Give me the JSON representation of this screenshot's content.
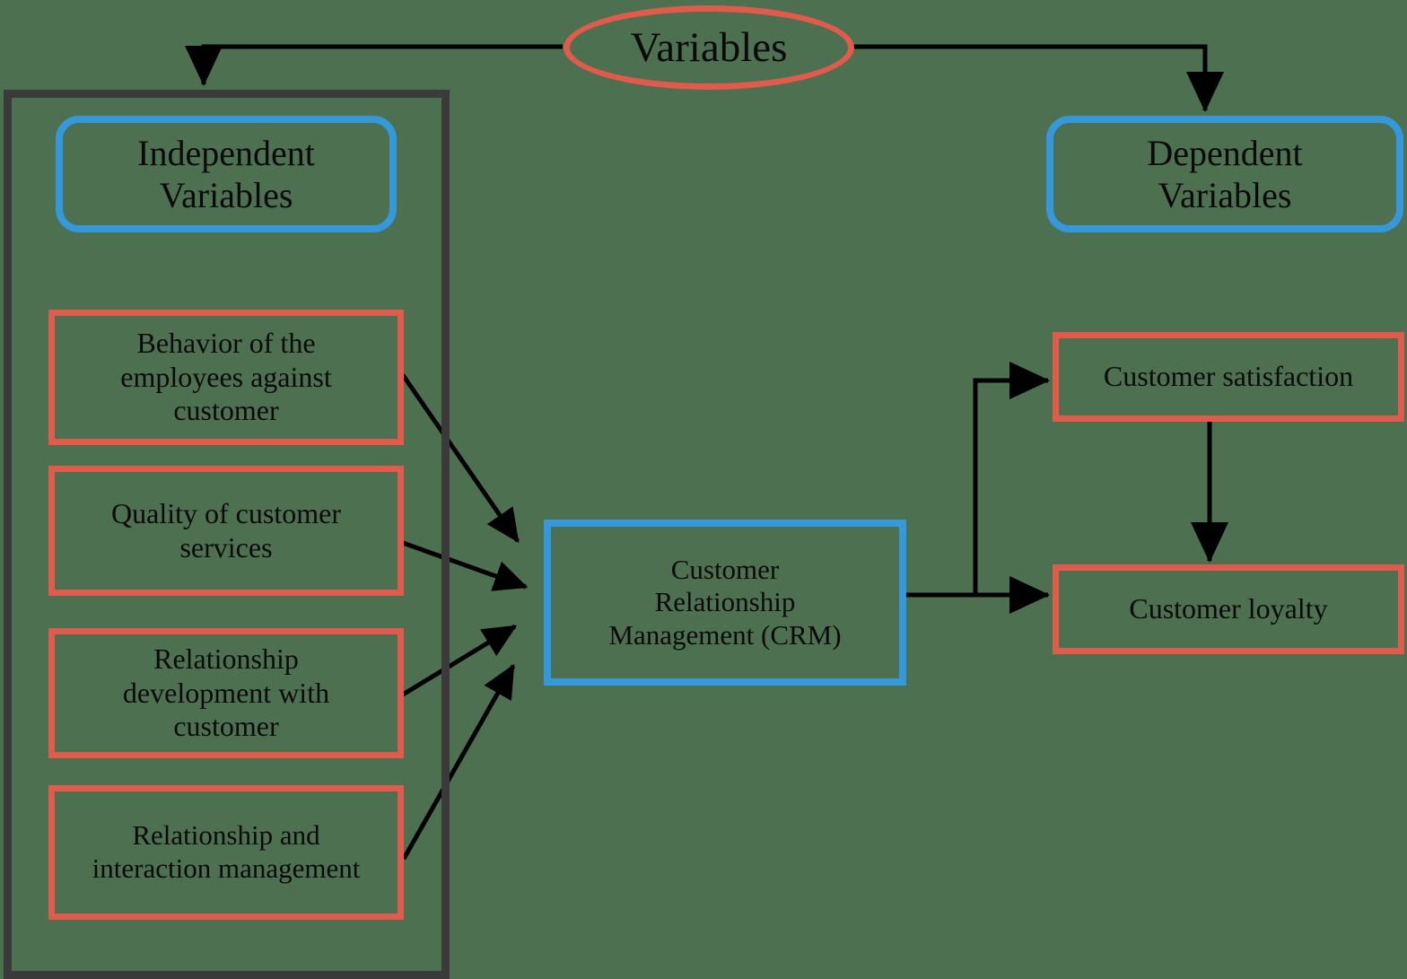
{
  "diagram": {
    "title_node": {
      "label": "Variables"
    },
    "independent": {
      "header": "Independent\nVariables",
      "items": [
        {
          "id": "behavior",
          "label": "Behavior of the\nemployees against\ncustomer"
        },
        {
          "id": "quality",
          "label": "Quality of customer\nservices"
        },
        {
          "id": "development",
          "label": "Relationship\ndevelopment with\ncustomer"
        },
        {
          "id": "interaction",
          "label": "Relationship and\ninteraction management"
        }
      ]
    },
    "mediator": {
      "id": "crm",
      "label": "Customer\nRelationship\nManagement (CRM)"
    },
    "dependent": {
      "header": "Dependent\nVariables",
      "items": [
        {
          "id": "satisfaction",
          "label": "Customer  satisfaction"
        },
        {
          "id": "loyalty",
          "label": "Customer loyalty"
        }
      ]
    },
    "colors": {
      "accent_red": "#E15B4C",
      "accent_blue": "#3498DB",
      "container_gray": "#3A3A3A",
      "connector": "#000000",
      "background": "#4C7050",
      "text": "#0A0A0A"
    },
    "edges": [
      {
        "from": "variables",
        "to": "independent-group"
      },
      {
        "from": "variables",
        "to": "dependent-header"
      },
      {
        "from": "behavior",
        "to": "crm"
      },
      {
        "from": "quality",
        "to": "crm"
      },
      {
        "from": "development",
        "to": "crm"
      },
      {
        "from": "interaction",
        "to": "crm"
      },
      {
        "from": "crm",
        "to": "satisfaction"
      },
      {
        "from": "crm",
        "to": "loyalty"
      },
      {
        "from": "satisfaction",
        "to": "loyalty"
      }
    ]
  }
}
